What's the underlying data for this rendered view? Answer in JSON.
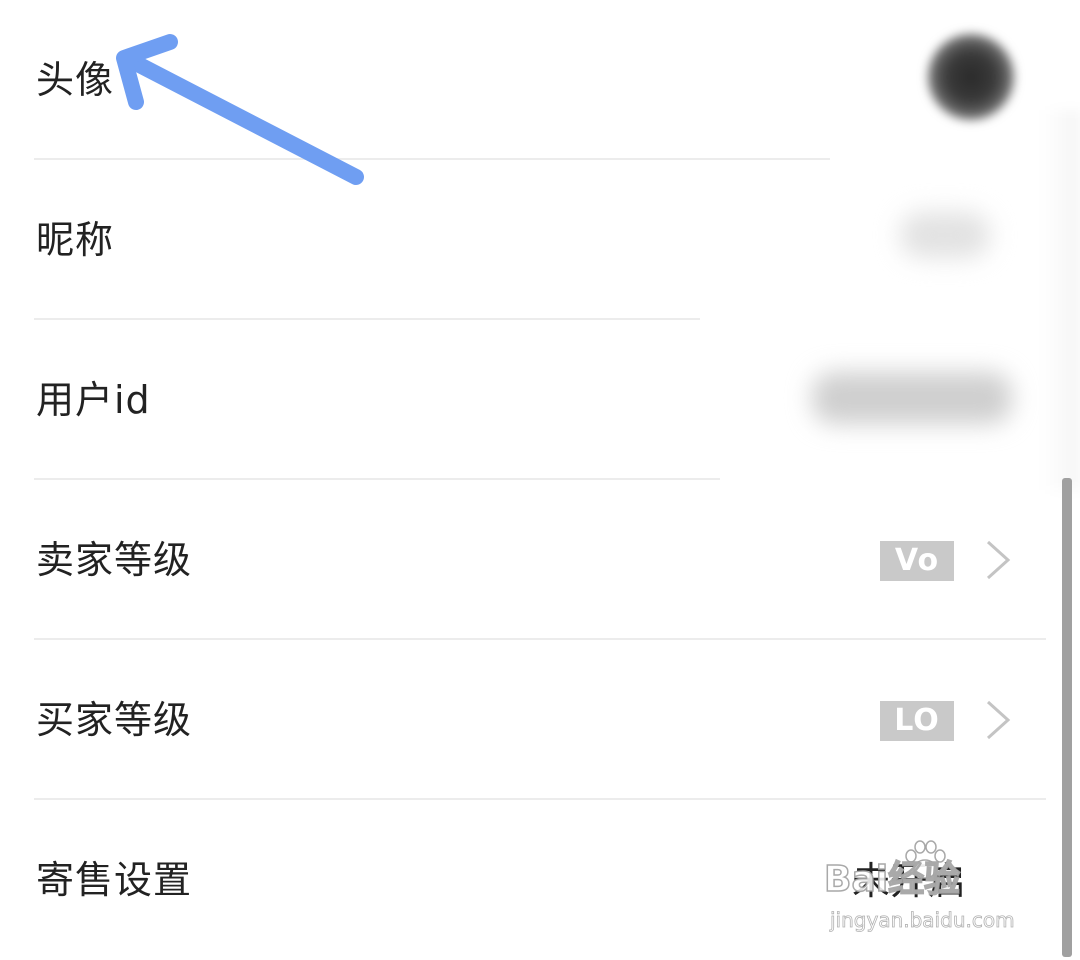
{
  "rows": [
    {
      "label": "头像"
    },
    {
      "label": "昵称"
    },
    {
      "label": "用户id"
    },
    {
      "label": "卖家等级",
      "badge": "Vo"
    },
    {
      "label": "买家等级",
      "badge": "LO"
    },
    {
      "label": "寄售设置",
      "value": "未开启"
    }
  ],
  "watermark": {
    "brand": "Bai经验",
    "url": "jingyan.baidu.com"
  },
  "colors": {
    "arrow": "#6f9ef2",
    "badge": "#c9c9c9",
    "divider": "#ececec"
  },
  "icons": [
    "annotation-arrow-icon",
    "chevron-right-icon",
    "paw-icon"
  ]
}
